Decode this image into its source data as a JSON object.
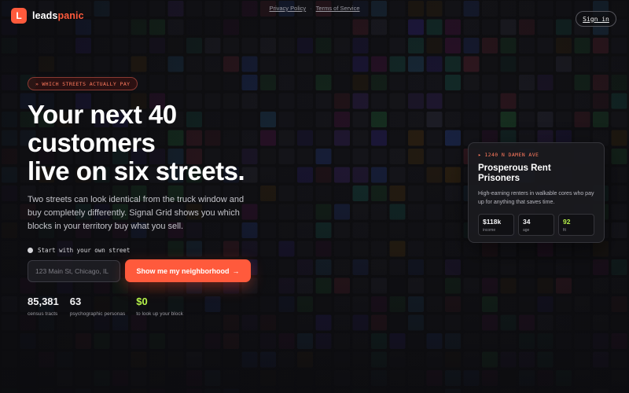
{
  "brand": {
    "logo_letter": "L",
    "name_white": "leads",
    "name_accent": "panic",
    "accent_color": "#ff5a3c"
  },
  "toplinks": {
    "privacy": "Privacy Policy",
    "separator": "·",
    "terms": "Terms of Service"
  },
  "signin_label": "Sign in",
  "hero": {
    "eyebrow_marker": "»",
    "eyebrow": "WHICH STREETS ACTUALLY PAY",
    "headline": [
      "Your next 40",
      "customers",
      "live on six streets."
    ],
    "subtext": "Two streets can look identical from the truck window and buy completely differently. Signal Grid shows you which blocks in your territory buy what you sell.",
    "start_label": "Start with your own street",
    "address_placeholder": "123 Main St, Chicago, IL",
    "cta_label": "Show me my neighborhood",
    "cta_arrow": "→",
    "stats": [
      {
        "value": "85,381",
        "label": "census tracts"
      },
      {
        "value": "63",
        "label": "psychographic personas"
      },
      {
        "value": "$0",
        "label": "to look up your block"
      }
    ]
  },
  "card": {
    "marker": "▸",
    "address": "1240 N DAMEN AVE",
    "title": "Prosperous Rent Prisoners",
    "description": "High-earning renters in walkable cores who pay up for anything that saves time.",
    "metrics": [
      {
        "value": "$118k",
        "label": "income"
      },
      {
        "value": "34",
        "label": "age"
      },
      {
        "value": "92",
        "label": "fit"
      }
    ]
  },
  "colors": {
    "background": "#0f0f12",
    "fit_green": "#b6f24a",
    "eyebrow_red": "#ff7a5e"
  }
}
